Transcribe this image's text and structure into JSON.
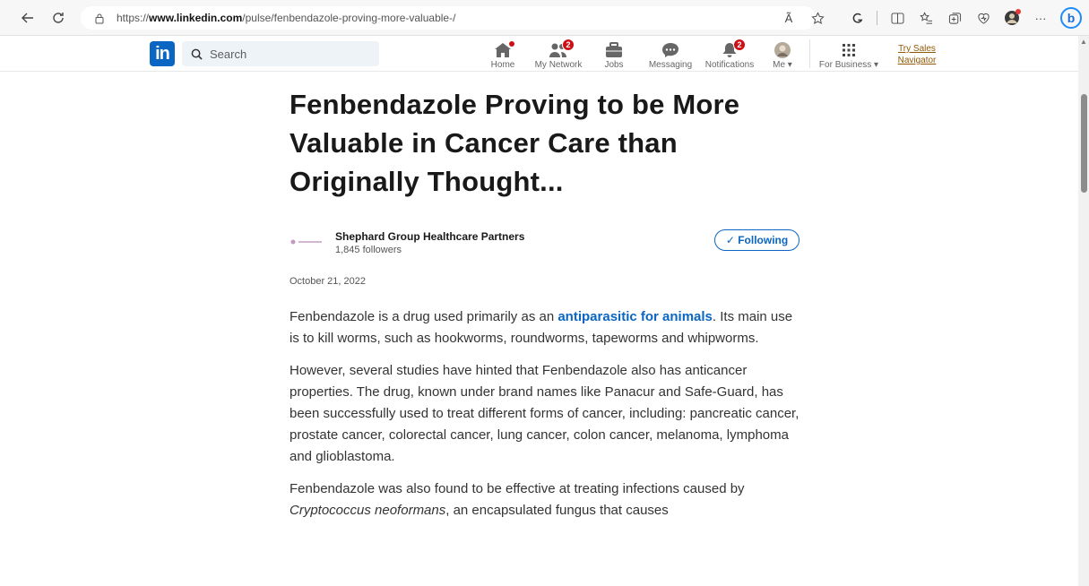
{
  "browser": {
    "back_icon": "arrow-left-icon",
    "refresh_icon": "refresh-icon",
    "url_prefix": "https://",
    "url_host": "www.linkedin.com",
    "url_path": "/pulse/fenbendazole-proving-more-valuable-/",
    "read_aloud": "Ã",
    "more": "···",
    "bing": "b"
  },
  "linkedin": {
    "logo_text": "in",
    "search_placeholder": "Search",
    "nav": [
      {
        "label": "Home",
        "badge": ""
      },
      {
        "label": "My Network",
        "badge": "2"
      },
      {
        "label": "Jobs",
        "badge": ""
      },
      {
        "label": "Messaging",
        "badge": ""
      },
      {
        "label": "Notifications",
        "badge": "2"
      },
      {
        "label": "Me ▾",
        "badge": ""
      },
      {
        "label": "For Business ▾",
        "badge": ""
      }
    ],
    "sales_link": "Try Sales Navigator",
    "accent_color": "#0a66c2",
    "badge_color": "#cc1016"
  },
  "article": {
    "title": "Fenbendazole Proving to be More Valuable in Cancer Care than Originally Thought...",
    "author": {
      "name": "Shephard Group Healthcare Partners",
      "followers": "1,845 followers",
      "follow_label": "✓ Following"
    },
    "date": "October 21, 2022",
    "paragraph1_before": "Fenbendazole is a drug used primarily as an ",
    "paragraph1_link": "antiparasitic for animals",
    "paragraph1_after": ". Its main use is to kill worms, such as hookworms, roundworms, tapeworms and whipworms.",
    "paragraph2": "However, several studies have hinted that Fenbendazole also has anticancer properties. The drug, known under brand names like Panacur and Safe-Guard, has been successfully used to treat different forms of cancer, including: pancreatic cancer, prostate cancer, colorectal cancer, lung cancer, colon cancer, melanoma, lymphoma and glioblastoma.",
    "paragraph3_before": "Fenbendazole was also found to be effective at treating infections caused by ",
    "paragraph3_italic": "Cryptococcus neoformans",
    "paragraph3_after": ", an encapsulated fungus that causes"
  }
}
